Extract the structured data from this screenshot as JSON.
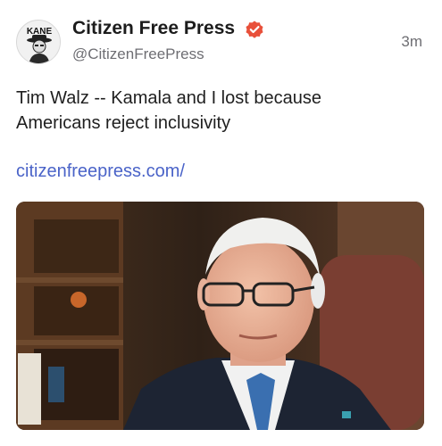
{
  "post": {
    "author": {
      "avatar_text": "KANE",
      "display_name": "Citizen Free Press",
      "handle": "@CitizenFreePress",
      "verified_icon": "verified-badge-icon"
    },
    "timestamp": "3m",
    "text": "Tim Walz -- Kamala and I lost because Americans reject inclusivity",
    "link": "citizenfreepress.com/",
    "media": {
      "kind": "photo"
    }
  },
  "colors": {
    "verified_badge": "#e8503a",
    "link": "#4a63c8",
    "secondary_text": "#6e6e73"
  }
}
